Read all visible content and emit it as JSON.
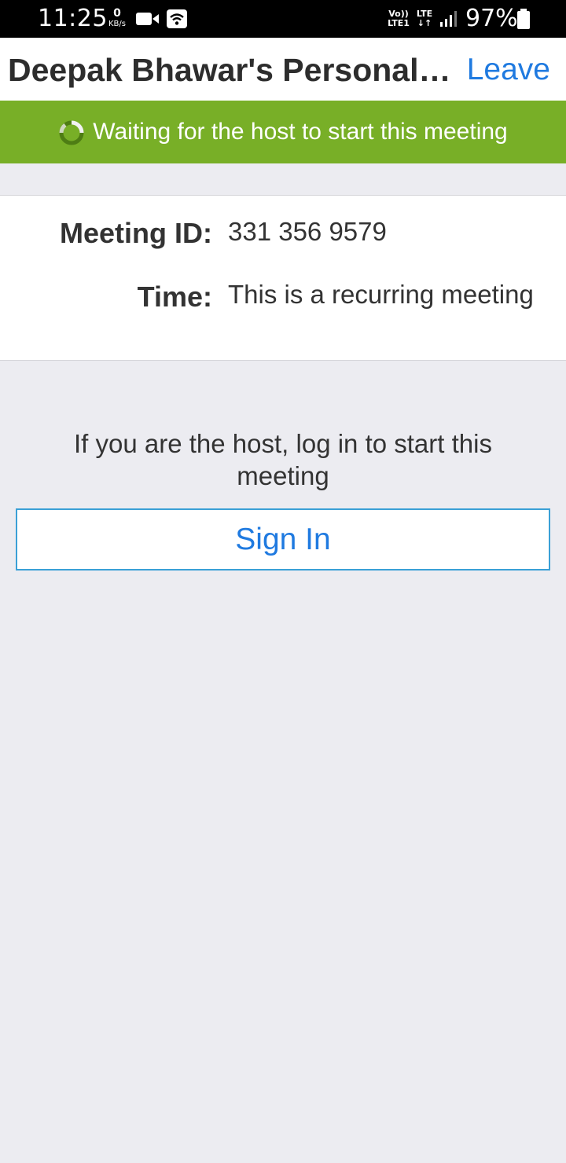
{
  "status_bar": {
    "time": "11:25",
    "net_speed_value": "0",
    "net_speed_unit": "KB/s",
    "volte_line1": "Vo))",
    "volte_line2": "LTE1",
    "lte_label": "LTE",
    "lte_arrows": "↓↑",
    "battery_percent": "97%",
    "icons": [
      "video-camera-icon",
      "wifi-icon",
      "signal-icon",
      "battery-icon"
    ]
  },
  "header": {
    "title": "Deepak Bhawar's Personal Meeting Room",
    "leave_label": "Leave"
  },
  "banner": {
    "text": "Waiting for the host to start this meeting",
    "icon": "spinner-icon"
  },
  "meeting_info": {
    "id_label": "Meeting ID:",
    "id_value": "331 356 9579",
    "time_label": "Time:",
    "time_value": "This is a recurring meeting"
  },
  "host_section": {
    "hint": "If you are the host, log in to start this meeting",
    "sign_in_label": "Sign In"
  },
  "colors": {
    "banner_green": "#78af27",
    "link_blue": "#1f7ae0",
    "button_border": "#3aa0d6",
    "page_background": "#ececf1"
  }
}
